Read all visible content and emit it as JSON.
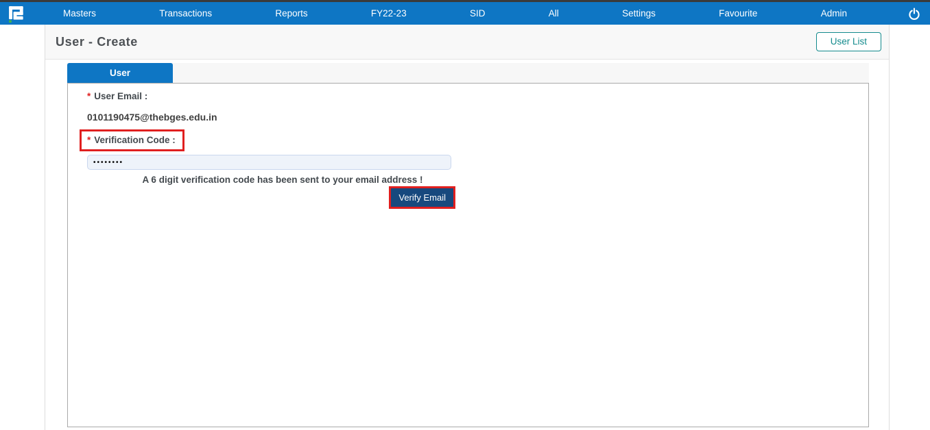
{
  "nav": {
    "items": [
      {
        "label": "Masters"
      },
      {
        "label": "Transactions"
      },
      {
        "label": "Reports"
      },
      {
        "label": "FY22-23"
      },
      {
        "label": "SID"
      },
      {
        "label": "All"
      },
      {
        "label": "Settings"
      },
      {
        "label": "Favourite"
      },
      {
        "label": "Admin"
      }
    ]
  },
  "header": {
    "title": "User - Create",
    "user_list_button": "User List"
  },
  "tabs": {
    "user_tab": "User"
  },
  "form": {
    "required_marker": "*",
    "user_email_label": "User Email :",
    "user_email_value": "0101190475@thebges.edu.in",
    "verification_code_label": "Verification Code :",
    "verification_code_value": "••••••••",
    "helper_text": "A 6 digit verification code has been sent to your email address !",
    "verify_button": "Verify Email"
  },
  "colors": {
    "nav_blue": "#0e76c4",
    "navy_button": "#17497e",
    "annotation_red": "#e01f1f",
    "teal": "#128a8c",
    "logo_green": "#43b649",
    "top_strip": "#3a3a3a"
  }
}
